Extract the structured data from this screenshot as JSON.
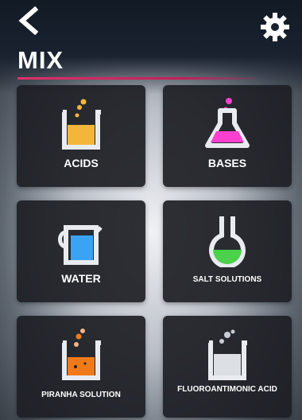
{
  "header": {
    "title": "MIX",
    "back_icon": "chevron-left-icon",
    "settings_icon": "gear-icon"
  },
  "categories": [
    {
      "label": "ACIDS",
      "icon": "beaker-yellow-icon",
      "color": "#f4b63a"
    },
    {
      "label": "BASES",
      "icon": "flask-pink-icon",
      "color": "#ff3fd0"
    },
    {
      "label": "WATER",
      "icon": "jug-blue-icon",
      "color": "#3aa3f4"
    },
    {
      "label": "SALT SOLUTIONS",
      "icon": "round-flask-green-icon",
      "color": "#4cd14c"
    },
    {
      "label": "PIRANHA SOLUTION",
      "icon": "beaker-orange-icon",
      "color": "#f07a1a"
    },
    {
      "label": "FLUOROANTIMONIC ACID",
      "icon": "beaker-clear-icon",
      "color": "#dcdfe4"
    }
  ],
  "colors": {
    "accent": "#d6246a",
    "tile_bg": "#1c1e24"
  }
}
